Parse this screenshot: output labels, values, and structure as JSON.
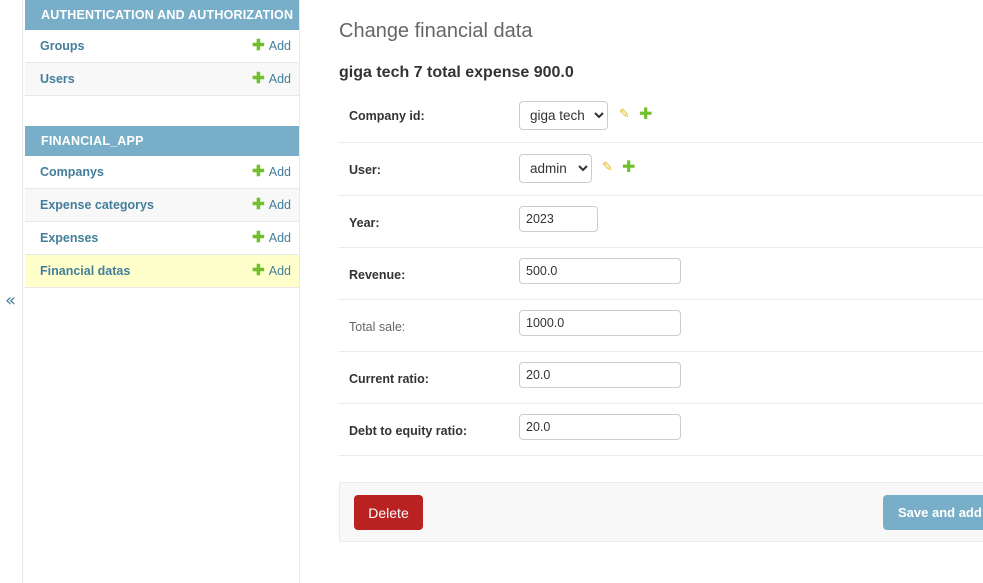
{
  "sidebar": {
    "collapse_symbol": "«",
    "modules": [
      {
        "caption": "AUTHENTICATION AND AUTHORIZATION",
        "models": [
          {
            "name": "Groups",
            "add": "Add"
          },
          {
            "name": "Users",
            "add": "Add"
          }
        ]
      },
      {
        "caption": "FINANCIAL_APP",
        "models": [
          {
            "name": "Companys",
            "add": "Add"
          },
          {
            "name": "Expense categorys",
            "add": "Add"
          },
          {
            "name": "Expenses",
            "add": "Add"
          },
          {
            "name": "Financial datas",
            "add": "Add"
          }
        ]
      }
    ],
    "plus_symbol": "✚"
  },
  "page": {
    "title": "Change financial data",
    "object_title": "giga tech 7 total expense 900.0"
  },
  "form": {
    "company_id": {
      "label": "Company id:",
      "value": "giga tech"
    },
    "user": {
      "label": "User:",
      "value": "admin"
    },
    "year": {
      "label": "Year:",
      "value": "2023"
    },
    "revenue": {
      "label": "Revenue:",
      "value": "500.0"
    },
    "total_sale": {
      "label": "Total sale:",
      "value": "1000.0"
    },
    "current_ratio": {
      "label": "Current ratio:",
      "value": "20.0"
    },
    "debt_to_equity_ratio": {
      "label": "Debt to equity ratio:",
      "value": "20.0"
    }
  },
  "icons": {
    "pencil": "✎",
    "plus": "✚"
  },
  "submit": {
    "delete_label": "Delete",
    "save_add_label": "Save and add another"
  },
  "colors": {
    "caption_bg": "#79aec8",
    "link": "#447e9b",
    "add_plus": "#70bf2b",
    "current_row": "#ffffcc",
    "delete": "#ba2121"
  }
}
